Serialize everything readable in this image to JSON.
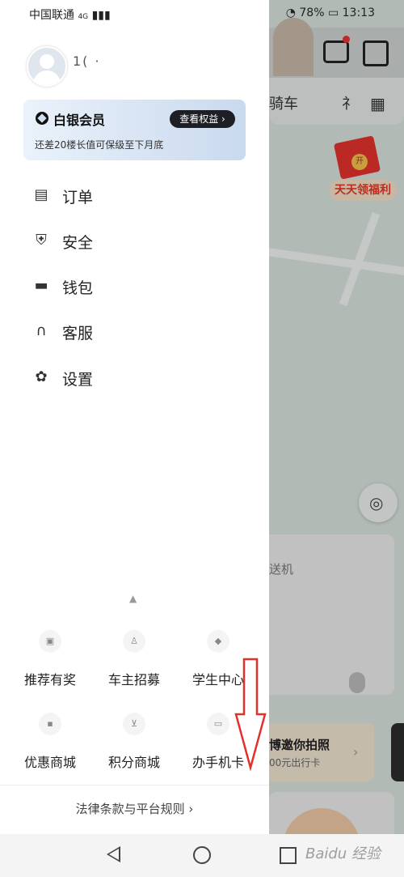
{
  "status_bar": {
    "carrier": "中国联通",
    "network": "4G",
    "battery": "78%",
    "time": "13:13"
  },
  "drawer": {
    "user": {
      "name": "1(  ·"
    },
    "member_card": {
      "title": "白银会员",
      "subtitle": "还差20楼长值可保级至下月底",
      "button": "查看权益 ›"
    },
    "menu": [
      {
        "label": "订单",
        "icon": "order-icon"
      },
      {
        "label": "安全",
        "icon": "shield-icon"
      },
      {
        "label": "钱包",
        "icon": "wallet-icon"
      },
      {
        "label": "客服",
        "icon": "headset-icon"
      },
      {
        "label": "设置",
        "icon": "settings-icon"
      }
    ],
    "grid": [
      {
        "label": "推荐有奖",
        "icon": "gift-icon"
      },
      {
        "label": "车主招募",
        "icon": "driver-icon"
      },
      {
        "label": "学生中心",
        "icon": "student-cap-icon"
      },
      {
        "label": "优惠商城",
        "icon": "shop-icon"
      },
      {
        "label": "积分商城",
        "icon": "cart-icon"
      },
      {
        "label": "办手机卡",
        "icon": "sim-card-icon"
      }
    ],
    "legal": "法律条款与平台规则 ›"
  },
  "background": {
    "tab1": "骑车",
    "tab2": "礻",
    "redpack_label": "天天领福利",
    "redpack_coin": "开",
    "card_text": "送机",
    "promo_title": "博邀你拍照",
    "promo_sub": "00元出行卡",
    "promo_arrow": "›"
  },
  "watermark": "Baidu 经验"
}
